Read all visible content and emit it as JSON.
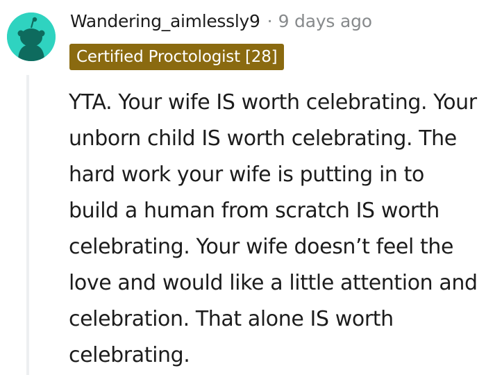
{
  "comment": {
    "author": "Wandering_aimlessly9",
    "separator": "·",
    "timestamp": "9 days ago",
    "flair": "Certified Proctologist [28]",
    "body": "YTA. Your wife IS worth celebrating. Your unborn child IS worth celebrating. The hard work your wife is putting in to build a human from scratch IS worth celebrating. Your wife doesn’t feel the love and would like a little attention and celebration. That alone IS worth celebrating."
  },
  "colors": {
    "avatar_bg": "#2fd3c0",
    "flair_bg": "#8a6a10",
    "meta_text": "#878a8c",
    "body_text": "#1c1c1c",
    "thread_line": "#edeff1"
  },
  "icons": {
    "avatar": "snoo-avatar-icon"
  }
}
